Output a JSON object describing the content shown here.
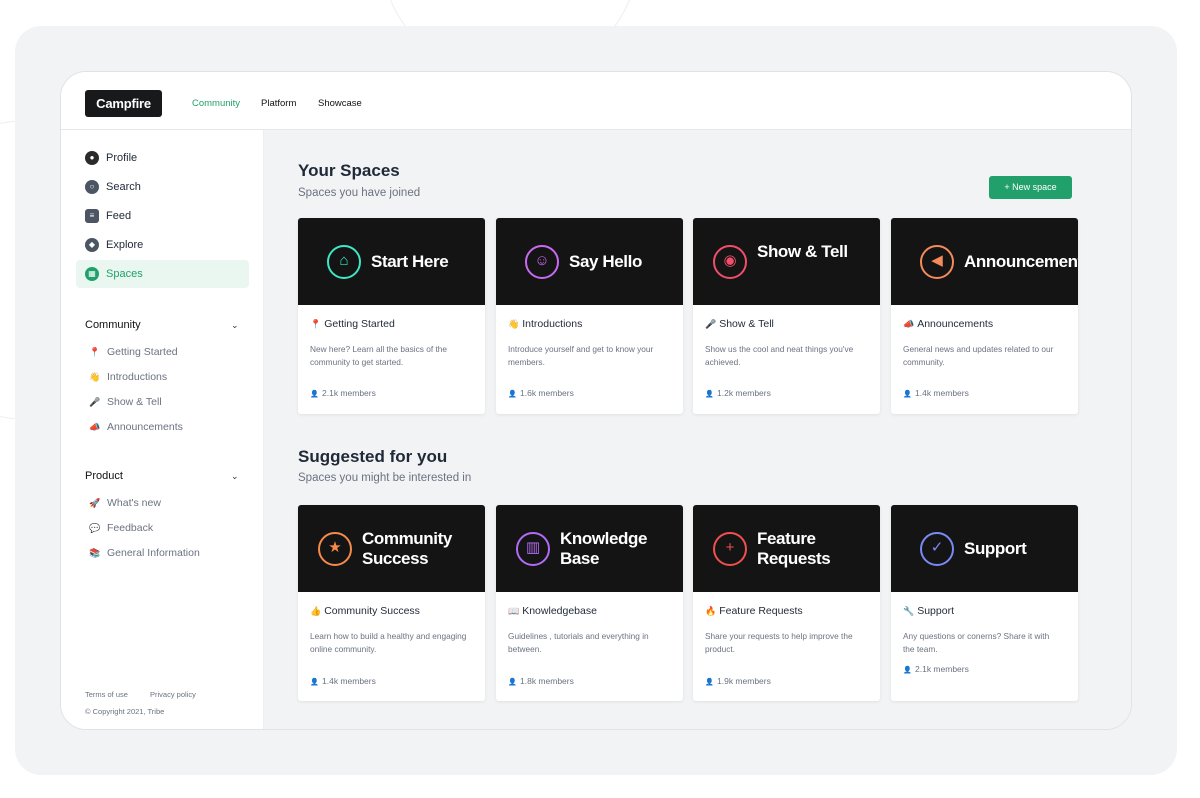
{
  "brand": "Campfire",
  "nav": [
    "Community",
    "Platform",
    "Showcase"
  ],
  "sidebar": {
    "items": [
      {
        "label": "Profile",
        "icon": "avatar"
      },
      {
        "label": "Search",
        "icon": "search-icon"
      },
      {
        "label": "Feed",
        "icon": "feed-icon"
      },
      {
        "label": "Explore",
        "icon": "compass-icon"
      },
      {
        "label": "Spaces",
        "icon": "grid-icon"
      }
    ],
    "sections": [
      {
        "title": "Community",
        "items": [
          {
            "emoji": "📍",
            "label": "Getting Started"
          },
          {
            "emoji": "👋",
            "label": "Introductions"
          },
          {
            "emoji": "🎤",
            "label": "Show & Tell"
          },
          {
            "emoji": "📣",
            "label": "Announcements"
          }
        ]
      },
      {
        "title": "Product",
        "items": [
          {
            "emoji": "🚀",
            "label": "What's new"
          },
          {
            "emoji": "💬",
            "label": "Feedback"
          },
          {
            "emoji": "📚",
            "label": "General Information"
          }
        ]
      }
    ],
    "footer": {
      "terms": "Terms of use",
      "privacy": "Privacy policy",
      "copyright": "© Copyright 2021, Tribe"
    }
  },
  "your_spaces": {
    "title": "Your Spaces",
    "subtitle": "Spaces you have joined",
    "new_space_label": "+ New space",
    "cards": [
      {
        "banner": "Start Here",
        "emoji": "📍",
        "title": "Getting Started",
        "desc": "New here? Learn all the basics of the community to get started.",
        "members": "2.1k members",
        "color": "#3de6c4",
        "glyph": "⌂"
      },
      {
        "banner": "Say Hello",
        "emoji": "👋",
        "title": "Introductions",
        "desc": "Introduce yourself and get to know your members.",
        "members": "1.6k members",
        "color": "#c86af0",
        "glyph": "☺"
      },
      {
        "banner": "Show & Tell",
        "emoji": "🎤",
        "title": "Show & Tell",
        "desc": "Show us the cool and neat things you've achieved.",
        "members": "1.2k members",
        "color": "#f04e6a",
        "glyph": "◉"
      },
      {
        "banner": "Announcement",
        "emoji": "📣",
        "title": "Announcements",
        "desc": "General news and updates related to our community.",
        "members": "1.4k members",
        "color": "#f58a5a",
        "glyph": "◀"
      }
    ]
  },
  "suggested": {
    "title": "Suggested for you",
    "subtitle": "Spaces you might be interested in",
    "cards": [
      {
        "banner": "Community Success",
        "emoji": "👍",
        "title": "Community Success",
        "desc": "Learn how to build a healthy and engaging online community.",
        "members": "1.4k members",
        "color": "#f58a4a",
        "glyph": "★"
      },
      {
        "banner": "Knowledge Base",
        "emoji": "📖",
        "title": "Knowledgebase",
        "desc": "Guidelines , tutorials and everything in between.",
        "members": "1.8k members",
        "color": "#b36af5",
        "glyph": "▥"
      },
      {
        "banner": "Feature Requests",
        "emoji": "🔥",
        "title": "Feature Requests",
        "desc": "Share your requests to help improve the product.",
        "members": "1.9k members",
        "color": "#f0504e",
        "glyph": "+"
      },
      {
        "banner": "Support",
        "emoji": "🔧",
        "title": "Support",
        "desc": "Any questions or conerns? Share it with the team.",
        "members": "2.1k members",
        "color": "#7a8af5",
        "glyph": "✓"
      }
    ]
  }
}
